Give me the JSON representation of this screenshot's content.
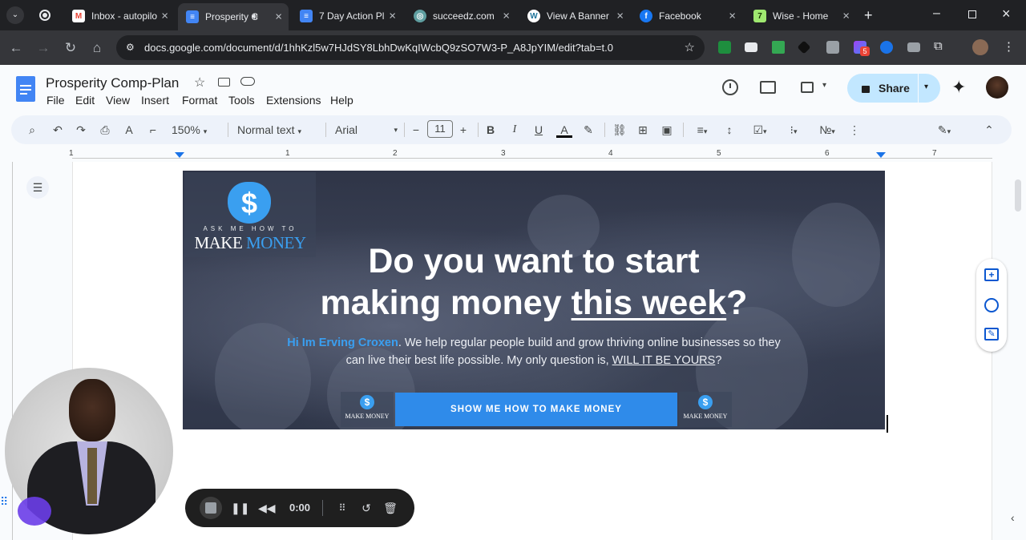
{
  "browser": {
    "tabs": [
      {
        "label": "Inbox - autopilo",
        "icon": "gmail-icon",
        "active": false
      },
      {
        "label": "Prosperity C",
        "icon": "docs-icon",
        "active": true
      },
      {
        "label": "7 Day Action Pl",
        "icon": "docs-icon",
        "active": false
      },
      {
        "label": "succeedz.com/",
        "icon": "globe-icon",
        "active": false
      },
      {
        "label": "View A Banner",
        "icon": "wordpress-icon",
        "active": false
      },
      {
        "label": "Facebook",
        "icon": "facebook-icon",
        "active": false
      },
      {
        "label": "Wise - Home",
        "icon": "wise-icon",
        "active": false
      }
    ],
    "url": "docs.google.com/document/d/1hhKzl5w7HJdSY8LbhDwKqIWcbQ9zSO7W3-P_A8JpYIM/edit?tab=t.0",
    "extension_badge": "5"
  },
  "doc": {
    "title": "Prosperity Comp-Plan",
    "menu": [
      "File",
      "Edit",
      "View",
      "Insert",
      "Format",
      "Tools",
      "Extensions",
      "Help"
    ],
    "share_label": "Share"
  },
  "toolbar": {
    "zoom": "150%",
    "style": "Normal text",
    "font": "Arial",
    "font_size": "11"
  },
  "ruler": {
    "numbers": [
      "1",
      "1",
      "2",
      "3",
      "4",
      "5",
      "6",
      "7"
    ]
  },
  "banner": {
    "logo_line1": "ASK ME HOW TO",
    "logo_line2a": "MAKE",
    "logo_line2b": "MONEY",
    "headline_line1": "Do you want to start",
    "headline_line2a": "making money ",
    "headline_line2b": "this week",
    "headline_line2c": "?",
    "sub_name": "Hi Im Erving Croxen",
    "sub_text1": ". We help regular people build and grow thriving online businesses so they",
    "sub_text2": "can live their best life possible. My only question is, ",
    "sub_link": "WILL IT BE YOURS",
    "sub_end": "?",
    "cta": "SHOW ME HOW TO MAKE MONEY",
    "mini_logo_a": "MAKE MONEY",
    "mini_logo_b": "MAKE MONEY"
  },
  "recorder": {
    "time": "0:00"
  },
  "colors": {
    "accent": "#0b57d0",
    "share_bg": "#c2e7ff",
    "cta": "#2f8bea",
    "brand_blue": "#3a9ff0"
  }
}
